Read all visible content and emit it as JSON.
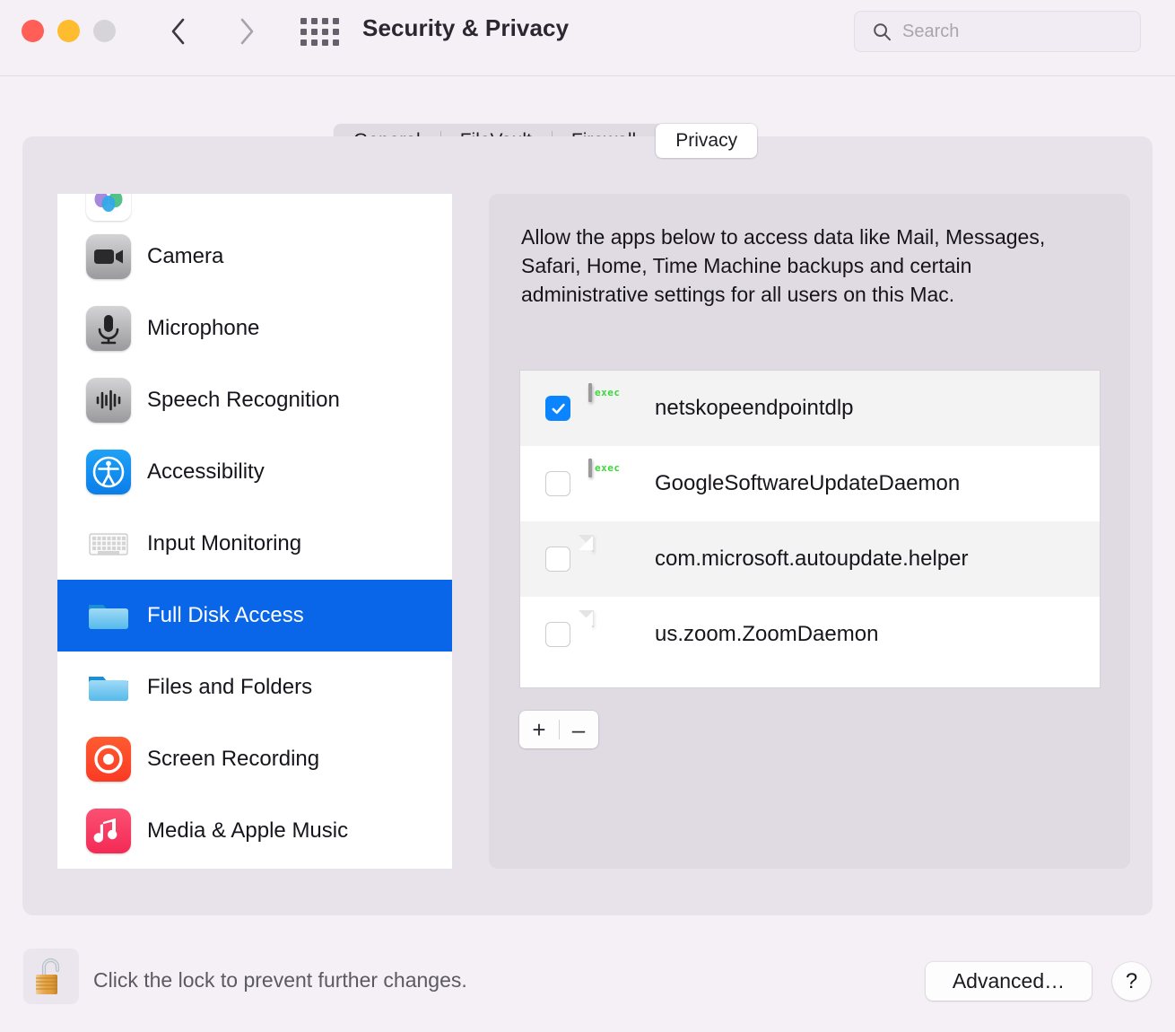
{
  "window": {
    "title": "Security & Privacy",
    "traffic_lights": [
      "close-red",
      "minimize-yellow",
      "zoom-gray-disabled"
    ],
    "nav": {
      "back": "back-chevron",
      "forward": "forward-chevron",
      "grid": "show-all-grid"
    }
  },
  "search": {
    "placeholder": "Search",
    "value": "",
    "icon": "magnifying-glass"
  },
  "tabs": [
    {
      "label": "General",
      "active": false
    },
    {
      "label": "FileVault",
      "active": false
    },
    {
      "label": "Firewall",
      "active": false
    },
    {
      "label": "Privacy",
      "active": true
    }
  ],
  "sidebar": {
    "items": [
      {
        "label": "",
        "icon": "photos-icon",
        "selected": false,
        "clipped": true
      },
      {
        "label": "Camera",
        "icon": "camera-icon",
        "selected": false
      },
      {
        "label": "Microphone",
        "icon": "microphone-icon",
        "selected": false
      },
      {
        "label": "Speech Recognition",
        "icon": "speech-recognition-icon",
        "selected": false
      },
      {
        "label": "Accessibility",
        "icon": "accessibility-icon",
        "selected": false
      },
      {
        "label": "Input Monitoring",
        "icon": "keyboard-icon",
        "selected": false
      },
      {
        "label": "Full Disk Access",
        "icon": "folder-icon",
        "selected": true
      },
      {
        "label": "Files and Folders",
        "icon": "folder-icon",
        "selected": false
      },
      {
        "label": "Screen Recording",
        "icon": "screen-recording-icon",
        "selected": false
      },
      {
        "label": "Media & Apple Music",
        "icon": "music-note-icon",
        "selected": false
      }
    ]
  },
  "content": {
    "description": "Allow the apps below to access data like Mail, Messages, Safari, Home, Time Machine backups and certain administrative settings for all users on this Mac.",
    "apps": [
      {
        "name": "netskopeendpointdlp",
        "checked": true,
        "icon": "exec-icon",
        "icon_label": "exec"
      },
      {
        "name": "GoogleSoftwareUpdateDaemon",
        "checked": false,
        "icon": "exec-icon",
        "icon_label": "exec"
      },
      {
        "name": "com.microsoft.autoupdate.helper",
        "checked": false,
        "icon": "generic-document-icon",
        "icon_label": ""
      },
      {
        "name": "us.zoom.ZoomDaemon",
        "checked": false,
        "icon": "generic-document-icon",
        "icon_label": ""
      }
    ],
    "add_label": "+",
    "remove_label": "–"
  },
  "footer": {
    "lock_icon": "unlocked-padlock",
    "lock_message": "Click the lock to prevent further changes.",
    "advanced_label": "Advanced…",
    "help_label": "?"
  },
  "colors": {
    "accent_blue": "#0a66e8",
    "checkbox_blue": "#0a84ff",
    "window_bg": "#f4f0f6",
    "panel_bg": "#e8e3ea",
    "content_bg": "#e0dbe2",
    "list_bg": "#ffffff",
    "row_alt_bg": "#f3f3f4"
  }
}
